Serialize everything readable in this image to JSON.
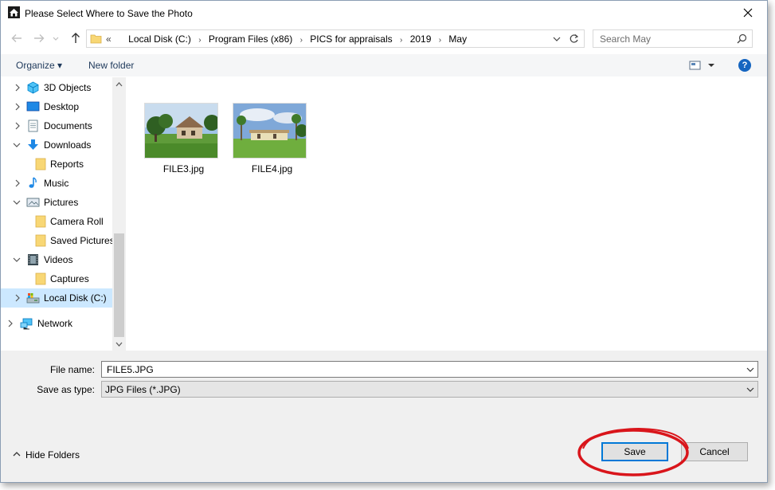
{
  "window": {
    "title": "Please Select Where to Save the Photo",
    "icon": "house-app-icon",
    "close_icon": "close-icon"
  },
  "navigation": {
    "back_icon": "back-arrow-icon",
    "forward_icon": "forward-arrow-icon",
    "recent_icon": "chevron-down-icon",
    "up_icon": "up-arrow-icon"
  },
  "address": {
    "overflow": "«",
    "crumbs": [
      "Local Disk (C:)",
      "Program Files (x86)",
      "PICS for appraisals",
      "2019",
      "May"
    ]
  },
  "search": {
    "placeholder": "Search May"
  },
  "toolbar": {
    "organize_label": "Organize ▾",
    "new_folder_label": "New folder",
    "help_label": "?"
  },
  "nav_tree": {
    "items": [
      {
        "label": "3D Objects",
        "icon": "3d-objects-icon",
        "expander": "collapsed"
      },
      {
        "label": "Desktop",
        "icon": "desktop-icon",
        "expander": "collapsed"
      },
      {
        "label": "Documents",
        "icon": "documents-icon",
        "expander": "collapsed"
      },
      {
        "label": "Downloads",
        "icon": "downloads-icon",
        "expander": "expanded"
      },
      {
        "label": "Reports",
        "icon": "folder-icon",
        "expander": "none"
      },
      {
        "label": "Music",
        "icon": "music-icon",
        "expander": "collapsed"
      },
      {
        "label": "Pictures",
        "icon": "pictures-icon",
        "expander": "expanded"
      },
      {
        "label": "Camera Roll",
        "icon": "folder-icon",
        "expander": "none"
      },
      {
        "label": "Saved Pictures",
        "icon": "folder-icon",
        "expander": "none"
      },
      {
        "label": "Videos",
        "icon": "videos-icon",
        "expander": "expanded"
      },
      {
        "label": "Captures",
        "icon": "folder-icon",
        "expander": "none"
      },
      {
        "label": "Local Disk (C:)",
        "icon": "drive-icon",
        "expander": "collapsed",
        "selected": true
      },
      {
        "label": "Network",
        "icon": "network-icon",
        "expander": "collapsed"
      }
    ]
  },
  "files": [
    {
      "name": "FILE3.jpg"
    },
    {
      "name": "FILE4.jpg"
    }
  ],
  "form": {
    "file_name_label": "File name:",
    "file_name_value": "FILE5.JPG",
    "save_type_label": "Save as type:",
    "save_type_value": "JPG Files (*.JPG)"
  },
  "footer": {
    "hide_folders_label": "Hide Folders",
    "save_label": "Save",
    "cancel_label": "Cancel"
  },
  "colors": {
    "accent": "#0078d7",
    "highlight_ring": "#d9151b",
    "selection": "#cce8ff"
  }
}
